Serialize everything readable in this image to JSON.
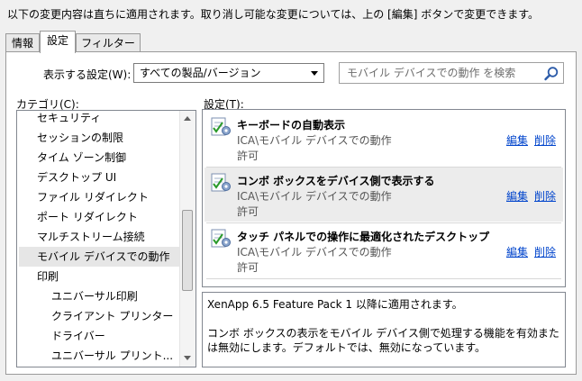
{
  "top_note": "以下の変更内容は直ちに適用されます。取り消し可能な変更については、上の [編集] ボタンで変更できます。",
  "tabs": [
    "情報",
    "設定",
    "フィルター"
  ],
  "display_label": "表示する設定(W):",
  "display_value": "すべての製品/バージョン",
  "search_placeholder": "モバイル デバイスでの動作 を検索",
  "categories_label": "カテゴリ(C):",
  "settings_label": "設定(T):",
  "categories": [
    "セキュリティ",
    "セッションの制限",
    "タイム ゾーン制御",
    "デスクトップ UI",
    "ファイル リダイレクト",
    "ポート リダイレクト",
    "マルチストリーム接続",
    "モバイル デバイスでの動作",
    "印刷",
    "ユニバーサル印刷",
    "クライアント プリンター",
    "ドライバー",
    "ユニバーサル プリント..."
  ],
  "settings": [
    {
      "title": "キーボードの自動表示",
      "path": "ICA\\モバイル デバイスでの動作",
      "state": "許可",
      "edit": "編集",
      "delete": "削除"
    },
    {
      "title": "コンボ ボックスをデバイス側で表示する",
      "path": "ICA\\モバイル デバイスでの動作",
      "state": "許可",
      "edit": "編集",
      "delete": "削除"
    },
    {
      "title": "タッチ パネルでの操作に最適化されたデスクトップ",
      "path": "ICA\\モバイル デバイスでの動作",
      "state": "許可",
      "edit": "編集",
      "delete": "削除"
    }
  ],
  "description": {
    "applies": "XenApp 6.5 Feature Pack 1 以降に適用されます。",
    "text": "コンボ ボックスの表示をモバイル デバイス側で処理する機能を有効または無効にします。デフォルトでは、無効になっています。"
  },
  "colors": {
    "link": "#0044cc",
    "selection": "#e6e6e6"
  }
}
